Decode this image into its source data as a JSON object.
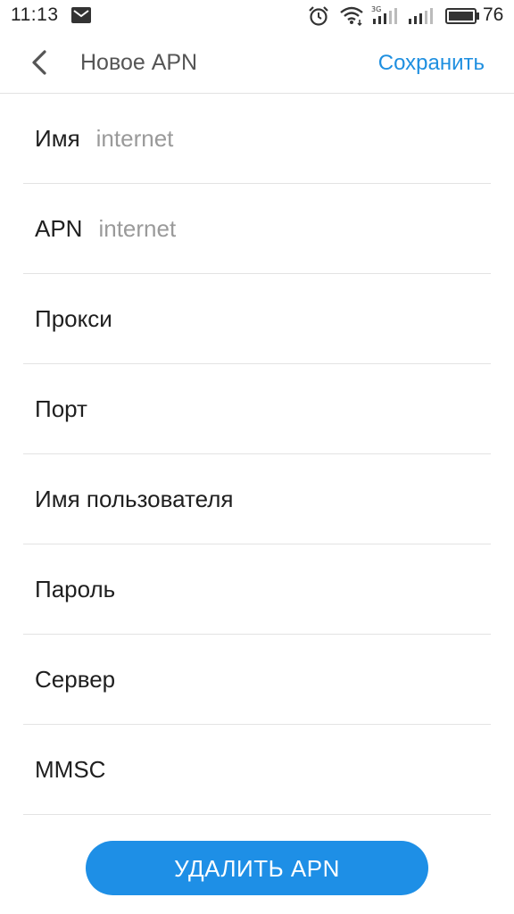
{
  "status_bar": {
    "time": "11:13",
    "network_type": "3G",
    "battery_level": "76",
    "icons": [
      "mail-notification-icon",
      "alarm-icon",
      "wifi-icon",
      "signal-3g-icon",
      "signal-icon",
      "battery-icon"
    ]
  },
  "header": {
    "title": "Новое APN",
    "save_label": "Сохранить"
  },
  "fields": [
    {
      "label": "Имя",
      "value": "internet"
    },
    {
      "label": "APN",
      "value": "internet"
    },
    {
      "label": "Прокси",
      "value": ""
    },
    {
      "label": "Порт",
      "value": ""
    },
    {
      "label": "Имя пользователя",
      "value": ""
    },
    {
      "label": "Пароль",
      "value": ""
    },
    {
      "label": "Сервер",
      "value": ""
    },
    {
      "label": "MMSC",
      "value": ""
    }
  ],
  "delete_button": {
    "label": "УДАЛИТЬ APN"
  },
  "colors": {
    "accent": "#1e8fe0",
    "button": "#1e8fe6",
    "divider": "#e3e3e3"
  }
}
